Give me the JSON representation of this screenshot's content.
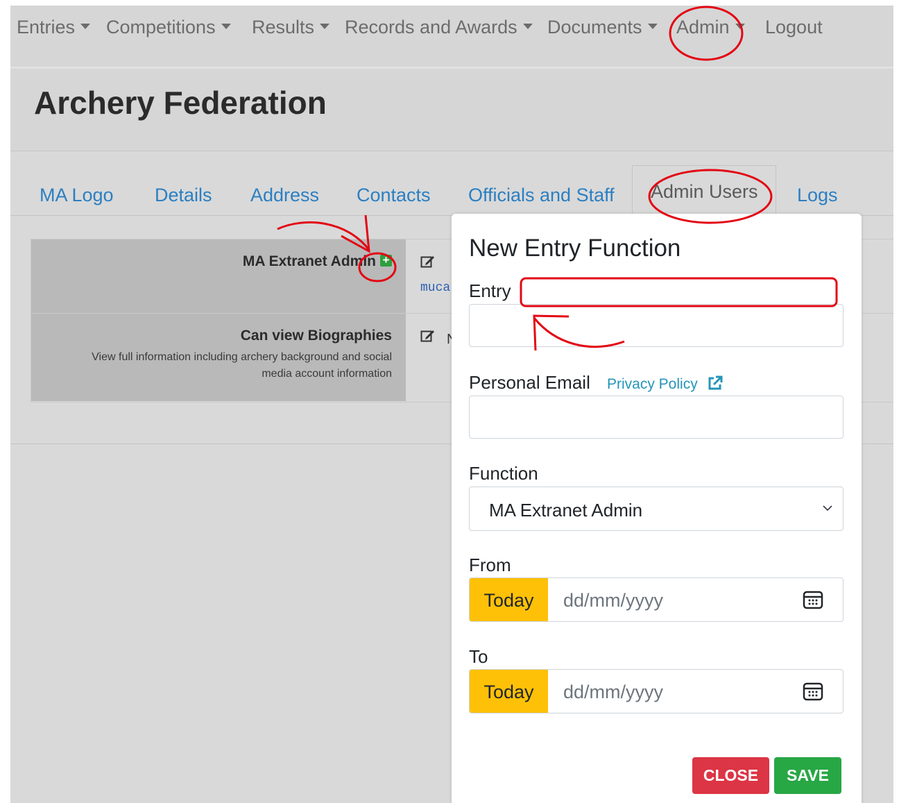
{
  "nav": {
    "items": [
      {
        "label": "Entries",
        "caret": true
      },
      {
        "label": "Competitions",
        "caret": true
      },
      {
        "label": "Results",
        "caret": true
      },
      {
        "label": "Records and Awards",
        "caret": true
      },
      {
        "label": "Documents",
        "caret": true
      },
      {
        "label": "Admin",
        "caret": true
      },
      {
        "label": "Logout",
        "caret": false
      }
    ]
  },
  "header": {
    "title": "Archery Federation"
  },
  "tabs": [
    {
      "label": "MA Logo",
      "active": false
    },
    {
      "label": "Details",
      "active": false
    },
    {
      "label": "Address",
      "active": false
    },
    {
      "label": "Contacts",
      "active": false
    },
    {
      "label": "Officials and Staff",
      "active": false
    },
    {
      "label": "Admin Users",
      "active": true
    },
    {
      "label": "Logs",
      "active": false
    }
  ],
  "permissions": [
    {
      "name": "MA Extranet Admin",
      "description": "",
      "value_partial": "muca"
    },
    {
      "name": "Can view Biographies",
      "description_line1": "View full information including archery background and social",
      "description_line2": "media account information",
      "value_partial": "N"
    }
  ],
  "modal": {
    "title": "New Entry Function",
    "entry_label": "Entry",
    "entry_value": "",
    "email_label": "Personal Email",
    "privacy_link": "Privacy Policy",
    "email_value": "",
    "function_label": "Function",
    "function_selected": "MA Extranet Admin",
    "from_label": "From",
    "to_label": "To",
    "today_label": "Today",
    "date_placeholder": "dd/mm/yyyy",
    "close_label": "CLOSE",
    "save_label": "SAVE"
  },
  "colors": {
    "link": "#2b7fc2",
    "today": "#ffc107",
    "close": "#dc3545",
    "save": "#28a745",
    "annotation": "#e30613"
  }
}
